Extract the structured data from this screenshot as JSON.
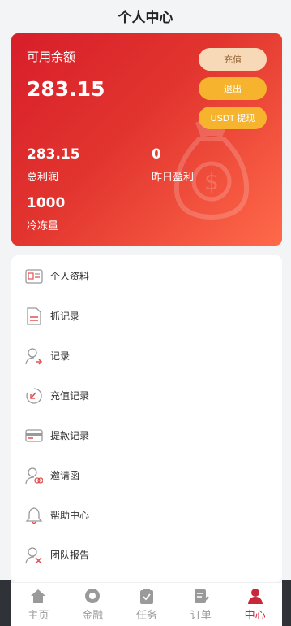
{
  "header": {
    "title": "个人中心"
  },
  "balance": {
    "available_label": "可用余额",
    "available_value": "283.15",
    "buttons": {
      "recharge": "充值",
      "logout": "退出",
      "withdraw": "USDT 提现"
    },
    "stats": [
      {
        "value": "283.15",
        "label": "总利润"
      },
      {
        "value": "0",
        "label": "昨日盈利"
      },
      {
        "value": "1000",
        "label": "冷冻量"
      }
    ]
  },
  "menu": {
    "items": [
      {
        "label": "个人资料",
        "icon": "id-card-icon"
      },
      {
        "label": "抓记录",
        "icon": "document-icon"
      },
      {
        "label": "记录",
        "icon": "user-arrow-icon"
      },
      {
        "label": "充值记录",
        "icon": "recharge-icon"
      },
      {
        "label": "提款记录",
        "icon": "card-icon"
      },
      {
        "label": "邀请函",
        "icon": "invite-icon"
      },
      {
        "label": "帮助中心",
        "icon": "bell-icon"
      },
      {
        "label": "团队报告",
        "icon": "team-icon"
      }
    ]
  },
  "tabbar": {
    "items": [
      {
        "label": "主页",
        "icon": "home-icon",
        "active": false
      },
      {
        "label": "金融",
        "icon": "finance-icon",
        "active": false
      },
      {
        "label": "任务",
        "icon": "clipboard-icon",
        "active": false
      },
      {
        "label": "订单",
        "icon": "order-icon",
        "active": false
      },
      {
        "label": "中心",
        "icon": "profile-icon",
        "active": true
      }
    ]
  },
  "colors": {
    "accent": "#d81e2a",
    "gold": "#f6b32d",
    "active_tab": "#c8283a"
  }
}
